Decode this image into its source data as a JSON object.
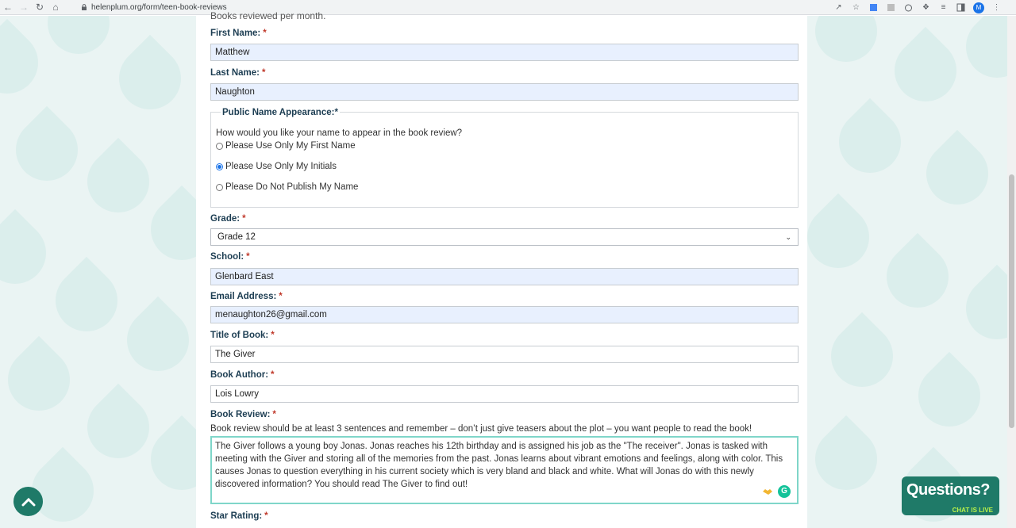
{
  "browser": {
    "url": "helenplum.org/form/teen-book-reviews",
    "avatar_letter": "M",
    "extension_icons": [
      "google-docs-icon",
      "notion-icon",
      "reddit-icon",
      "puzzle-icon",
      "reading-list-icon",
      "side-panel-icon"
    ]
  },
  "form": {
    "clipped_text": "Books reviewed per month.",
    "required_mark": "*",
    "first_name": {
      "label": "First Name:",
      "value": "Matthew"
    },
    "last_name": {
      "label": "Last Name:",
      "value": "Naughton"
    },
    "public_name": {
      "legend": "Public Name Appearance:",
      "question": "How would you like your name to appear in the book review?",
      "options": [
        {
          "label": "Please Use Only My First Name",
          "selected": false
        },
        {
          "label": "Please Use Only My Initials",
          "selected": true
        },
        {
          "label": "Please Do Not Publish My Name",
          "selected": false
        }
      ]
    },
    "grade": {
      "label": "Grade:",
      "value": "Grade 12"
    },
    "school": {
      "label": "School:",
      "value": "Glenbard East"
    },
    "email": {
      "label": "Email Address:",
      "value": "menaughton26@gmail.com"
    },
    "book_title": {
      "label": "Title of Book:",
      "value": "The Giver"
    },
    "book_author": {
      "label": "Book Author:",
      "value": "Lois Lowry"
    },
    "review": {
      "label": "Book Review:",
      "help": "Book review should be at least 3 sentences and remember – don’t just give teasers about the plot – you want people to read the book!",
      "value": "The Giver follows a young boy Jonas.  Jonas reaches his 12th birthday and is assigned his job as the \"The receiver\".  Jonas is tasked with meeting with the Giver and storing all of the memories from the past.  Jonas learns about vibrant emotions and feelings, along with color.  This causes Jonas to question everything in his current society which is very bland and black and white.  What will Jonas do with this newly discovered information?  You should read The Giver to find out!"
    },
    "star_rating": {
      "label": "Star Rating:"
    }
  },
  "chat_widget": {
    "title": "Questions?",
    "subtitle": "CHAT IS LIVE"
  },
  "colors": {
    "accent": "#1f7a68",
    "required": "#c0392b",
    "label": "#1c3d52",
    "autofill": "#e8f0fe"
  }
}
